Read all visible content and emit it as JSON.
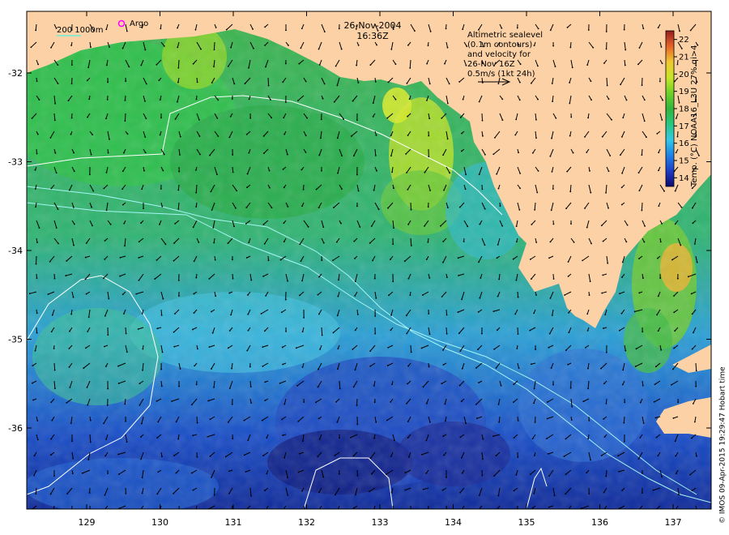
{
  "header": {
    "date": "26-Nov-2004",
    "time": "16:36Z"
  },
  "legend": {
    "isobath_label": "200  1000m",
    "argo_label": "Argo",
    "argo_color": "#ff00ff",
    "altimetry_lines": [
      "Altimetric sealevel",
      "(0.1m contours)",
      "and velocity for",
      "26-Nov 16Z",
      "0.5m/s (1kt 24h)"
    ]
  },
  "colorbar": {
    "title": "Temp. (°C) NOAA16_L3U 27% qi>4",
    "ticks": [
      "14",
      "15",
      "16",
      "17",
      "18",
      "19",
      "20",
      "21",
      "22"
    ],
    "min": 13.5,
    "max": 22.5,
    "colors": [
      "#0a0a6e",
      "#1e3cc8",
      "#1e82e6",
      "#32c8e6",
      "#28c882",
      "#32b43c",
      "#6ed228",
      "#c8e628",
      "#f0c832",
      "#e66428",
      "#961e1e"
    ]
  },
  "axes": {
    "x_ticks": [
      "129",
      "130",
      "131",
      "132",
      "133",
      "134",
      "135",
      "136",
      "137"
    ],
    "y_ticks": [
      "-32",
      "-33",
      "-34",
      "-35",
      "-36"
    ]
  },
  "colors": {
    "land": "#fbd1a5",
    "frame": "#000000"
  },
  "credit": "© IMOS 09-Apr-2015 19:29:47 Hobart time"
}
